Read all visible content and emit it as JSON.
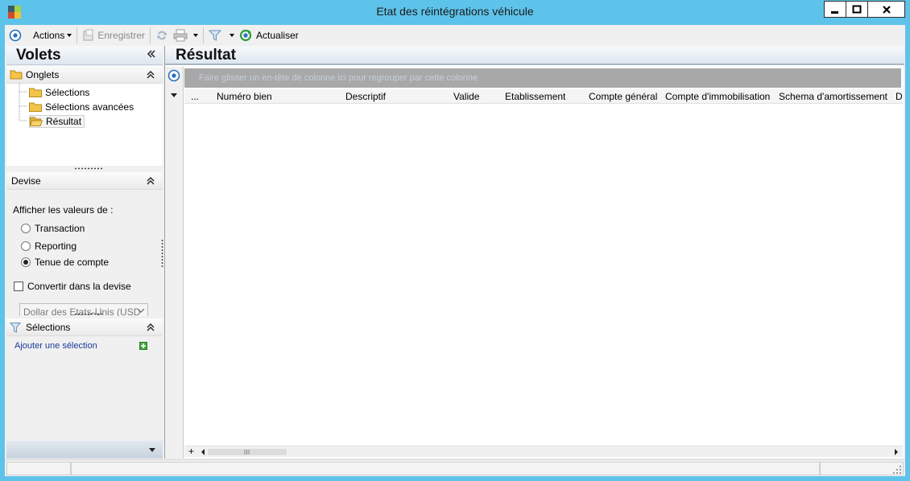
{
  "window": {
    "title": "Etat des réintégrations véhicule"
  },
  "toolbar": {
    "actions_label": "Actions",
    "save_label": "Enregistrer",
    "refresh_label": "Actualiser"
  },
  "left_panel": {
    "title": "Volets",
    "tabs_section": {
      "label": "Onglets",
      "items": [
        "Sélections",
        "Sélections avancées",
        "Résultat"
      ]
    },
    "currency_section": {
      "label": "Devise",
      "prompt": "Afficher les valeurs de :",
      "options": [
        "Transaction",
        "Reporting",
        "Tenue de compte"
      ],
      "selected_option": "Tenue de compte",
      "convert_label": "Convertir dans la devise",
      "convert_checked": false,
      "currency_value": "Dollar des Etats-Unis (USD"
    },
    "selections_section": {
      "label": "Sélections",
      "add_link": "Ajouter une sélection"
    }
  },
  "result_panel": {
    "title": "Résultat",
    "group_hint": "Faire glisser un en-tête de colonne ici pour regrouper par cette colonne",
    "columns": [
      "...",
      "Numéro bien",
      "Descriptif",
      "Valide",
      "Etablissement",
      "Compte général",
      "Compte d'immobilisation",
      "Schema d'amortissement",
      "D"
    ],
    "add_row_symbol": "+"
  },
  "colors": {
    "window_border": "#5ec3ea",
    "header_gradient_top": "#f7f9fc",
    "header_gradient_bottom": "#dde6ef",
    "link": "#1a3a9a"
  }
}
